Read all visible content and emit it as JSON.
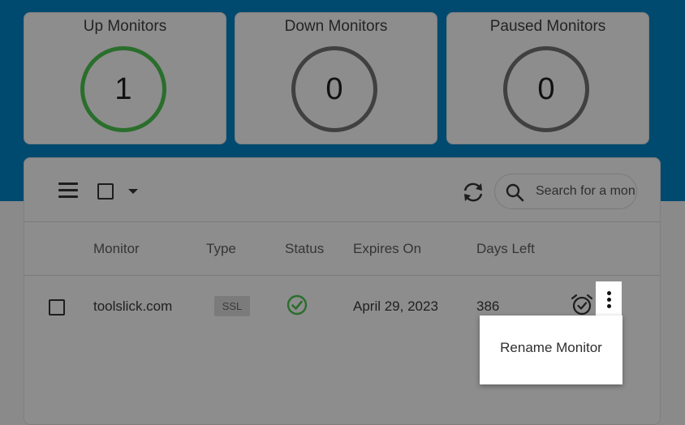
{
  "stats": {
    "up": {
      "title": "Up Monitors",
      "value": "1",
      "ring_color": "#2a6e2c"
    },
    "down": {
      "title": "Down Monitors",
      "value": "0",
      "ring_color": "#404040"
    },
    "paused": {
      "title": "Paused Monitors",
      "value": "0",
      "ring_color": "#404040"
    }
  },
  "toolbar": {
    "search_placeholder": "Search for a mon",
    "icons": [
      "menu-icon",
      "checkbox-icon",
      "chevron-down-icon",
      "refresh-icon",
      "search-icon"
    ]
  },
  "table": {
    "columns": [
      "Monitor",
      "Type",
      "Status",
      "Expires On",
      "Days Left"
    ],
    "rows": [
      {
        "monitor": "toolslick.com",
        "type": "SSL",
        "status": "up",
        "expires_on": "April 29, 2023",
        "days_left": "386"
      }
    ]
  },
  "row_menu": {
    "items": [
      "Rename Monitor"
    ]
  },
  "colors": {
    "header_band": "#004a6f",
    "status_ok": "#2a6e2c"
  }
}
